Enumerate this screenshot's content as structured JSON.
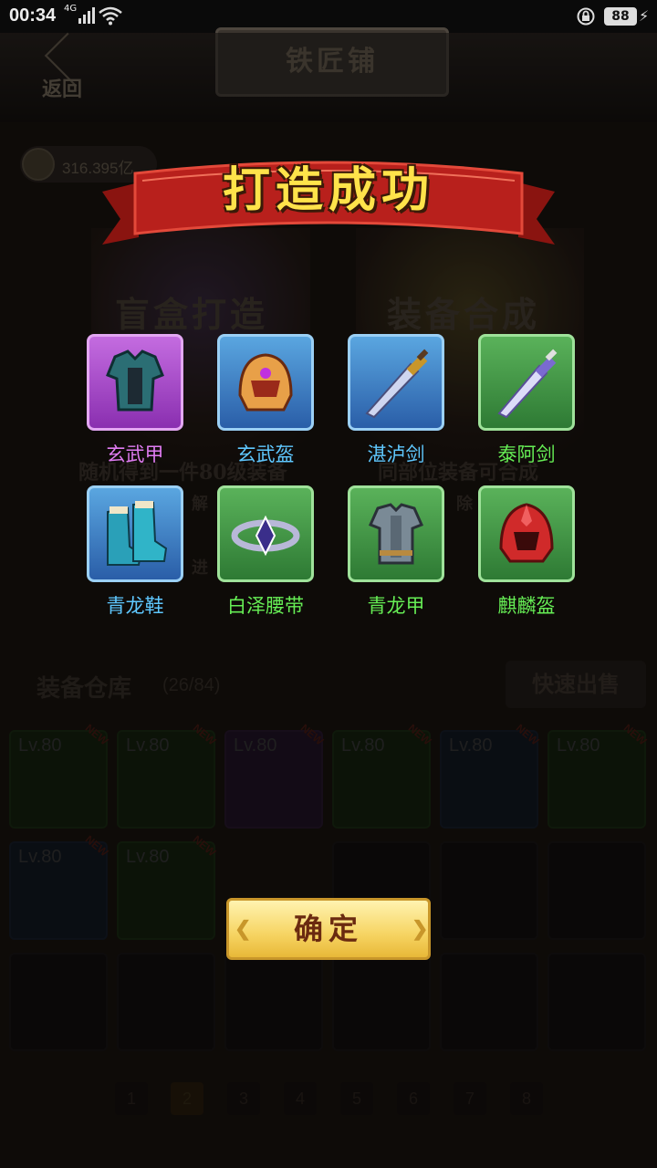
{
  "status_bar": {
    "time": "00:34",
    "network": "4G",
    "battery": "88"
  },
  "header": {
    "back_label": "返回",
    "title": "铁匠铺"
  },
  "currency": {
    "amount": "316.395亿"
  },
  "background": {
    "blind_box_title": "盲盒打造",
    "synthesis_title": "装备合成",
    "blind_box_desc": "随机得到一件80级装备",
    "synthesis_desc": "同部位装备可合成",
    "blind_box_sub": "解",
    "synthesis_sub": "除",
    "blind_box_btn": "进",
    "warehouse_title": "装备仓库",
    "warehouse_count": "(26/84)",
    "quick_sell": "快速出售",
    "slots": [
      {
        "level": "Lv.80",
        "badge": "NEW",
        "rarity": "green"
      },
      {
        "level": "Lv.80",
        "badge": "NEW",
        "rarity": "green"
      },
      {
        "level": "Lv.80",
        "badge": "NEW",
        "rarity": "purple"
      },
      {
        "level": "Lv.80",
        "badge": "NEW",
        "rarity": "green"
      },
      {
        "level": "Lv.80",
        "badge": "NEW",
        "rarity": "blue"
      },
      {
        "level": "Lv.80",
        "badge": "NEW",
        "rarity": "green"
      },
      {
        "level": "Lv.80",
        "badge": "NEW",
        "rarity": "blue"
      },
      {
        "level": "Lv.80",
        "badge": "NEW",
        "rarity": "green"
      }
    ],
    "pages": [
      "1",
      "2",
      "3",
      "4",
      "5",
      "6",
      "7",
      "8"
    ],
    "active_page": "2"
  },
  "result_dialog": {
    "banner_title": "打造成功",
    "items": [
      {
        "name": "玄武甲",
        "rarity": "purple",
        "icon": "armor-icon"
      },
      {
        "name": "玄武盔",
        "rarity": "blue",
        "icon": "helmet-icon"
      },
      {
        "name": "湛泸剑",
        "rarity": "blue",
        "icon": "sword-icon"
      },
      {
        "name": "泰阿剑",
        "rarity": "green",
        "icon": "sword-icon"
      },
      {
        "name": "青龙鞋",
        "rarity": "blue",
        "icon": "boots-icon"
      },
      {
        "name": "白泽腰带",
        "rarity": "green",
        "icon": "belt-icon"
      },
      {
        "name": "青龙甲",
        "rarity": "green",
        "icon": "armor-icon"
      },
      {
        "name": "麒麟盔",
        "rarity": "green",
        "icon": "helmet-icon"
      }
    ],
    "confirm_label": "确定"
  },
  "colors": {
    "banner_red": "#b8201c",
    "banner_text": "#ffe34a",
    "purple": "#e07cf2",
    "blue": "#5fc8ff",
    "green": "#66ee55",
    "confirm_bg": "#f6d462"
  }
}
